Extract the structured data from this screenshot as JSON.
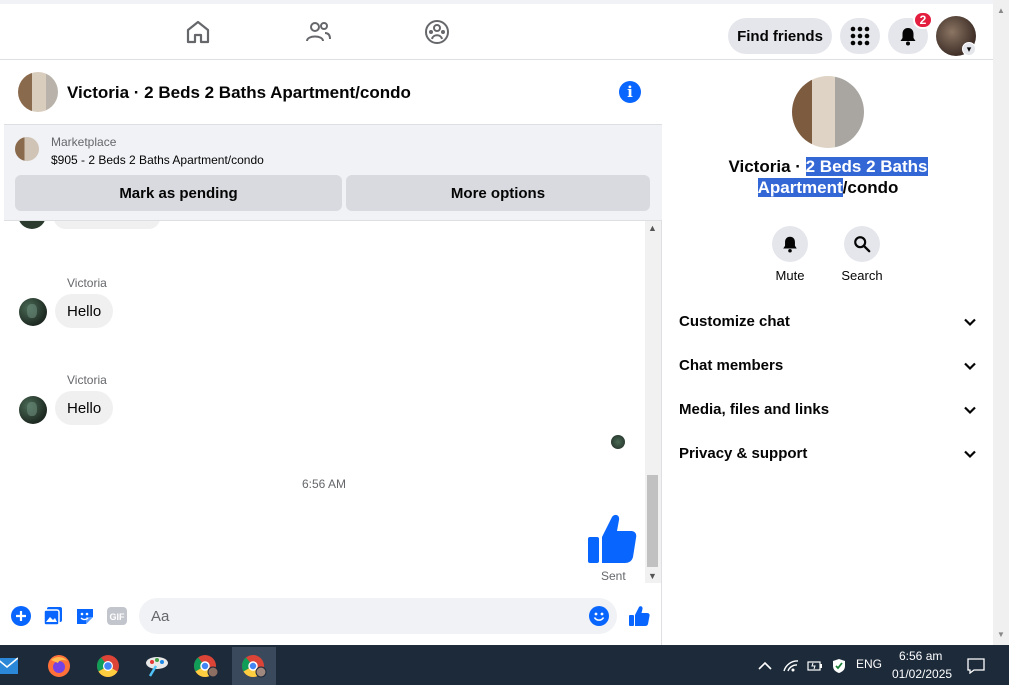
{
  "topnav": {
    "find_friends_label": "Find friends",
    "notification_count": "2"
  },
  "chat": {
    "header_title": "Victoria · 2 Beds 2 Baths Apartment/condo",
    "marketplace_label": "Marketplace",
    "listing_line": "$905 - 2 Beds 2 Baths Apartment/condo",
    "mark_pending_label": "Mark as pending",
    "more_options_label": "More options",
    "messages": [
      {
        "sender": "Victoria",
        "text": "Hello"
      },
      {
        "sender": "Victoria",
        "text": "Hello"
      }
    ],
    "timestamp": "6:56 AM",
    "sent_status": "Sent",
    "composer_placeholder": "Aa",
    "gif_label": "GIF"
  },
  "info": {
    "title_part1": "Victoria · ",
    "title_highlight": "2 Beds 2 Baths Apartment",
    "title_part2": "/condo",
    "actions": [
      {
        "label": "Mute",
        "icon": "bell-icon"
      },
      {
        "label": "Search",
        "icon": "search-icon"
      }
    ],
    "sections": [
      "Customize chat",
      "Chat members",
      "Media, files and links",
      "Privacy & support"
    ]
  },
  "taskbar": {
    "language": "ENG",
    "time": "6:56 am",
    "date": "01/02/2025"
  },
  "colors": {
    "accent": "#0866ff",
    "badge": "#e41e3f",
    "highlight": "#3367d6",
    "taskbar": "#1c2a3a"
  }
}
